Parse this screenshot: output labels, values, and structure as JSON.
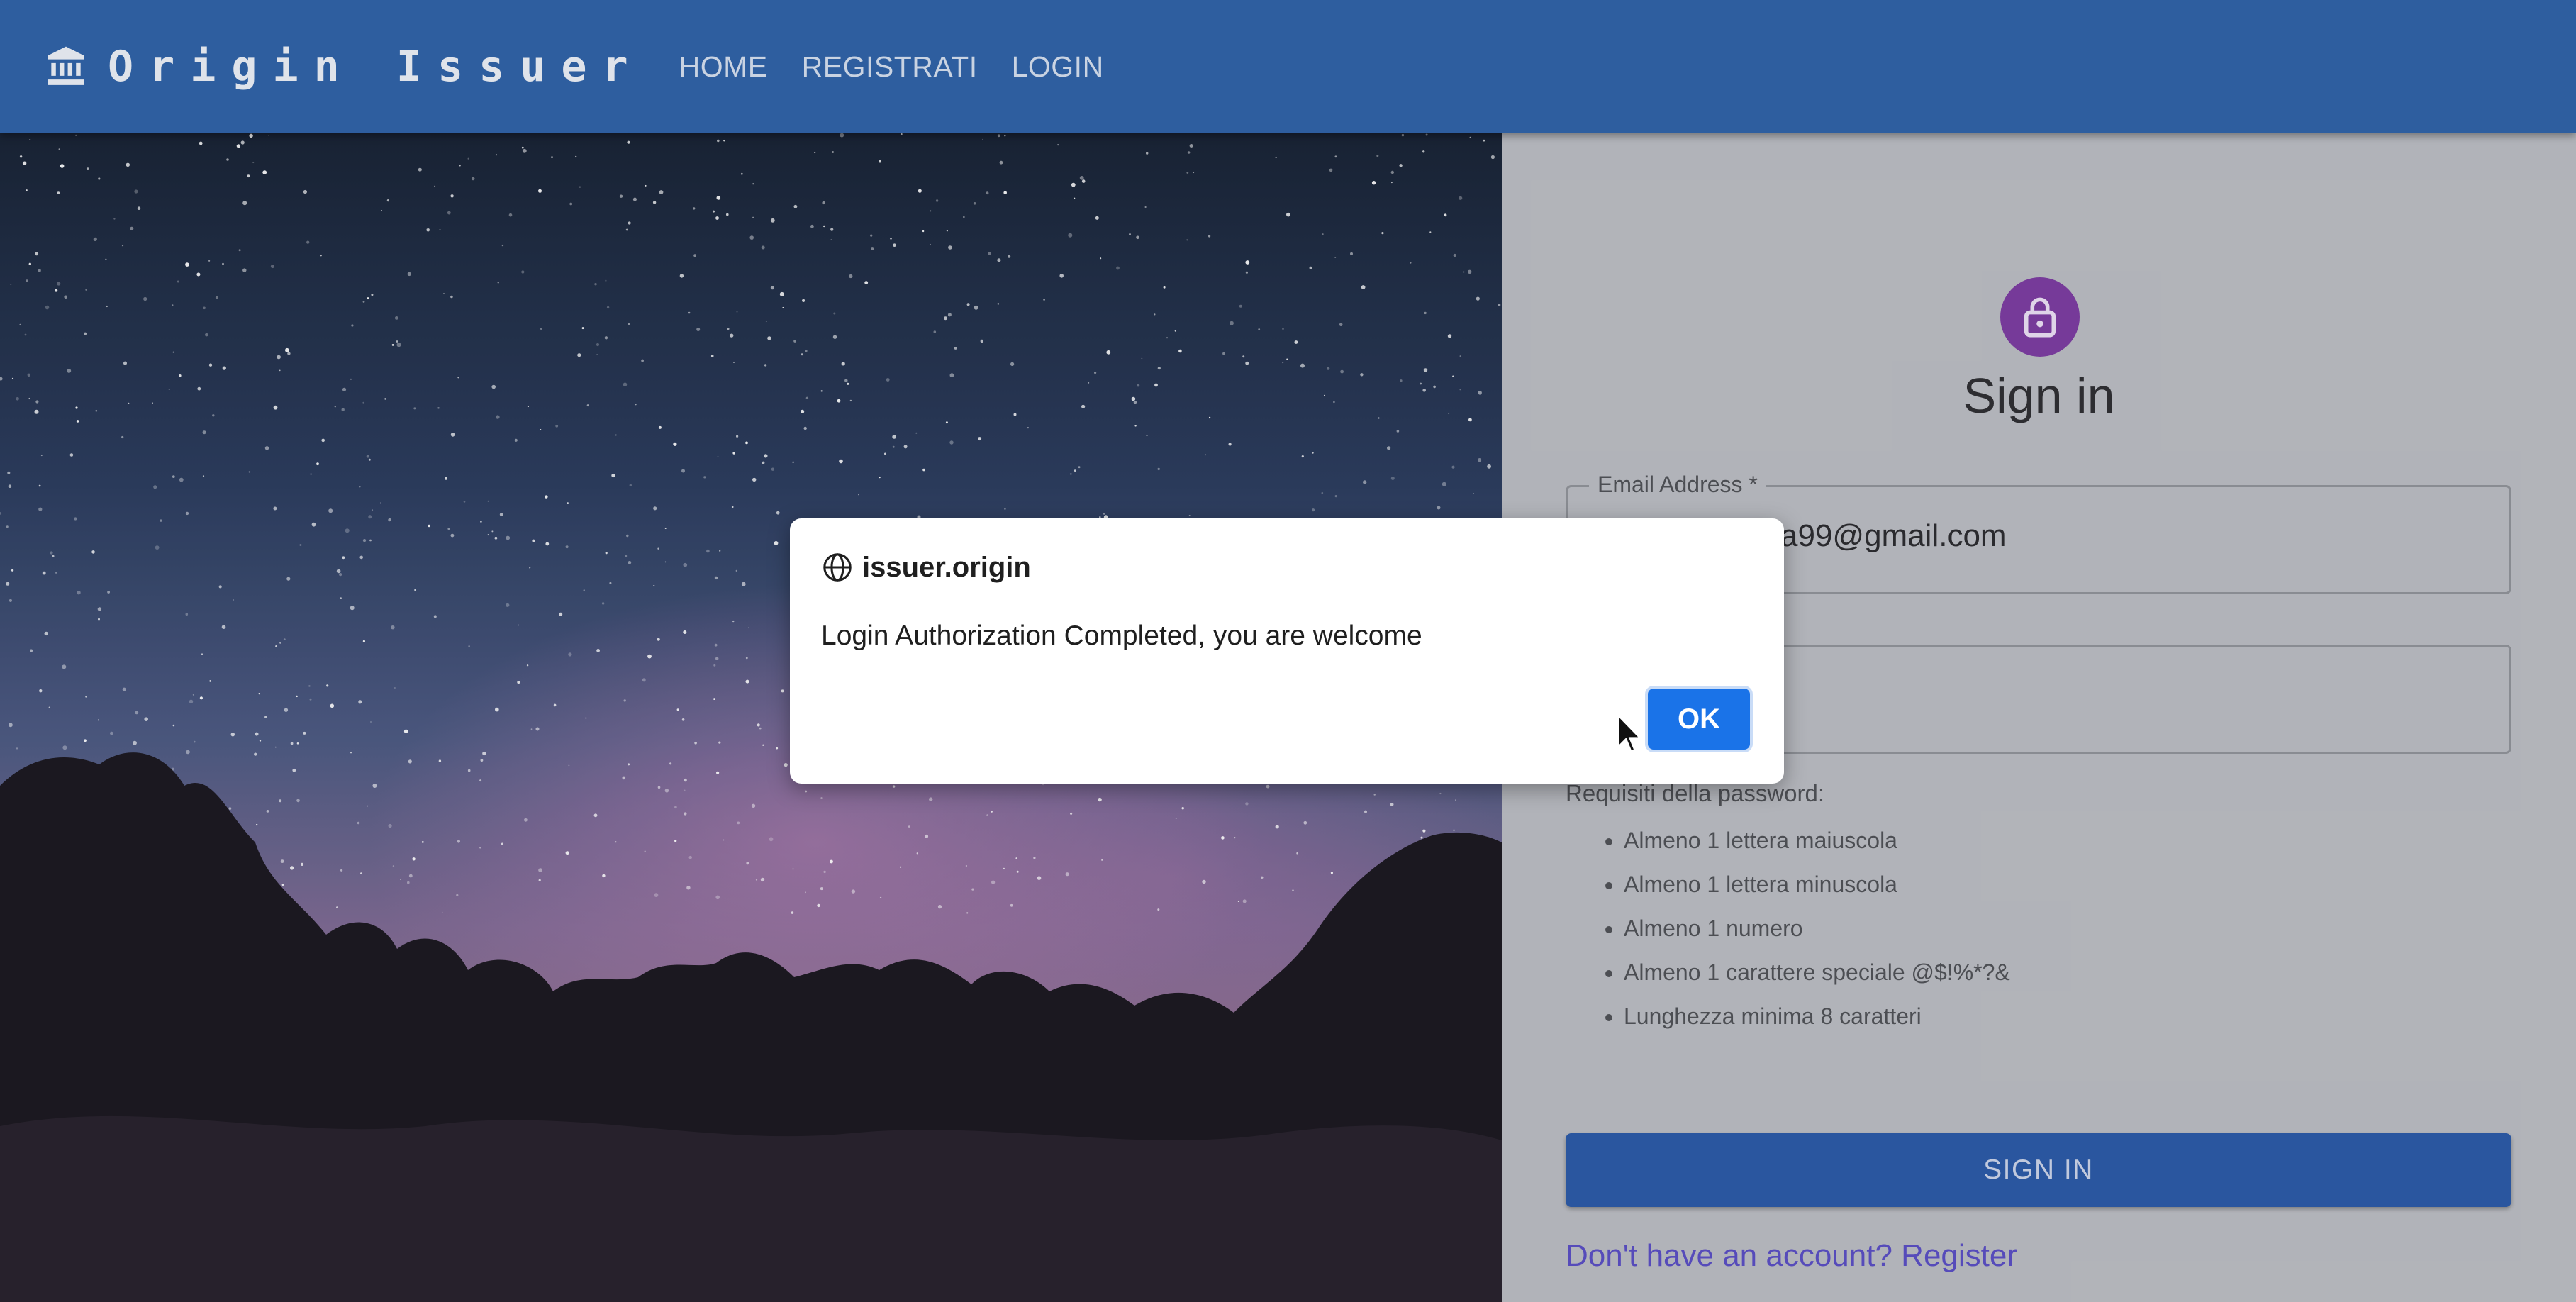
{
  "appbar": {
    "brand": "Origin Issuer",
    "brand_icon": "bank-icon",
    "nav": [
      "HOME",
      "REGISTRATI",
      "LOGIN"
    ],
    "color": "#2e5e9f"
  },
  "form": {
    "lock_icon": "lock-icon",
    "title": "Sign in",
    "email_label": "Email Address *",
    "email_value": "a99@gmail.com",
    "password_value": "",
    "requirements_title": "Requisiti della password:",
    "requirements": [
      "Almeno 1 lettera maiuscola",
      "Almeno 1 lettera minuscola",
      "Almeno 1 numero",
      "Almeno 1 carattere speciale @$!%*?&",
      "Lunghezza minima 8 caratteri"
    ],
    "signin_button": "SIGN IN",
    "register_link": "Don't have an account? Register",
    "accent": "#7b3da0"
  },
  "dialog": {
    "origin": "issuer.origin",
    "message": "Login Authorization Completed, you are welcome",
    "ok_label": "OK",
    "icon": "globe-icon",
    "button_color": "#1a73e8"
  }
}
